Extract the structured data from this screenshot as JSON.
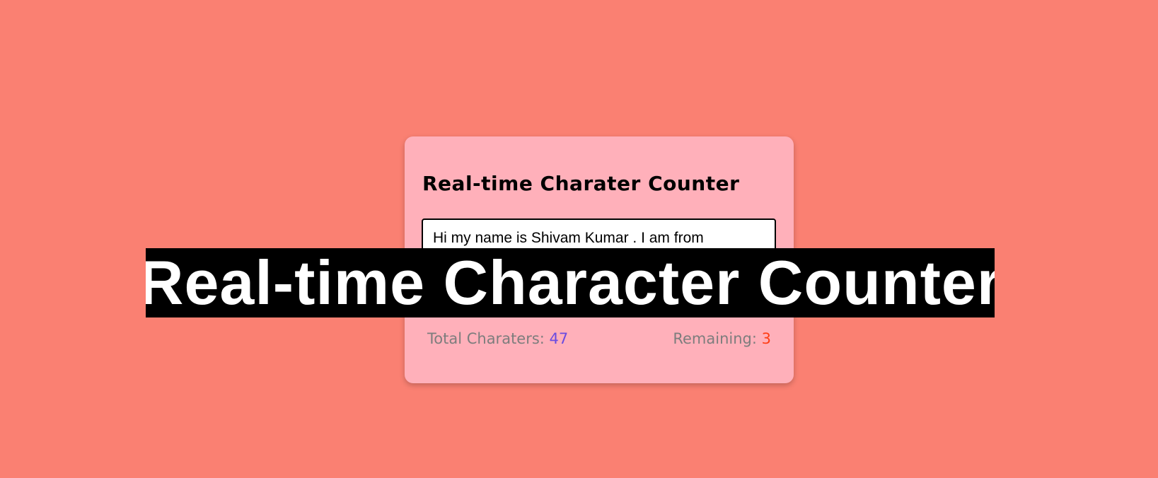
{
  "card": {
    "title": "Real-time Charater Counter",
    "textarea_value": "Hi my name is Shivam Kumar . I am from",
    "stats": {
      "total_label": "Total Charaters: ",
      "total_value": "47",
      "remaining_label": "Remaining: ",
      "remaining_value": "3"
    }
  },
  "overlay": {
    "title": "Real-time Character Counter"
  },
  "colors": {
    "background": "#fa8072",
    "card": "#ffb0ba",
    "total_value": "#6a4be0",
    "remaining_value": "#ff3d15"
  }
}
